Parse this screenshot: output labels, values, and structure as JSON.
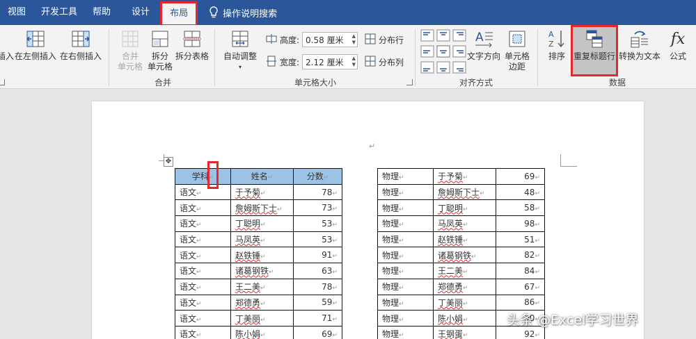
{
  "menubar": {
    "items": [
      "视图",
      "开发工具",
      "帮助",
      "设计",
      "布局"
    ],
    "search": "操作说明搜索"
  },
  "ribbon": {
    "rows_cols": {
      "insert_partial": "插入",
      "insert_left": "在左侧插入",
      "insert_right": "在右侧插入"
    },
    "merge": {
      "merge_cells_1": "合并",
      "merge_cells_2": "单元格",
      "split_cells_1": "拆分",
      "split_cells_2": "单元格",
      "split_table": "拆分表格",
      "label": "合并"
    },
    "cell_size": {
      "autofit": "自动调整",
      "height_label": "高度:",
      "height_value": "0.58 厘米",
      "width_label": "宽度:",
      "width_value": "2.12 厘米",
      "distribute_rows": "分布行",
      "distribute_cols": "分布列",
      "label": "单元格大小"
    },
    "alignment": {
      "text_direction": "文字方向",
      "cell_margins_1": "单元格",
      "cell_margins_2": "边距",
      "label": "对齐方式"
    },
    "data": {
      "sort": "排序",
      "repeat_header": "重复标题行",
      "convert_text": "转换为文本",
      "formula": "公式",
      "label": "数据"
    }
  },
  "table_left": {
    "headers": [
      "学科",
      "姓名",
      "分数"
    ],
    "rows": [
      [
        "语文",
        "于予菊",
        "78"
      ],
      [
        "语文",
        "詹姆斯下士",
        "73"
      ],
      [
        "语文",
        "丁聪明",
        "53"
      ],
      [
        "语文",
        "马凤英",
        "53"
      ],
      [
        "语文",
        "赵铁锤",
        "91"
      ],
      [
        "语文",
        "诸葛钢铁",
        "63"
      ],
      [
        "语文",
        "王二美",
        "78"
      ],
      [
        "语文",
        "郑德勇",
        "59"
      ],
      [
        "语文",
        "丁美丽",
        "71"
      ],
      [
        "语文",
        "陈小娟",
        "69"
      ]
    ]
  },
  "table_right": {
    "rows": [
      [
        "物理",
        "于予菊",
        "69"
      ],
      [
        "物理",
        "詹姆斯下士",
        "48"
      ],
      [
        "物理",
        "丁聪明",
        "58"
      ],
      [
        "物理",
        "马凤英",
        "98"
      ],
      [
        "物理",
        "赵铁锤",
        "51"
      ],
      [
        "物理",
        "诸葛钢铁",
        "82"
      ],
      [
        "物理",
        "王二美",
        "84"
      ],
      [
        "物理",
        "郑德勇",
        "67"
      ],
      [
        "物理",
        "丁美丽",
        "86"
      ],
      [
        "物理",
        "陈小娟",
        "90"
      ],
      [
        "物理",
        "王钢蛋",
        "92"
      ]
    ]
  },
  "watermark": "头条 @Excel学习世界",
  "colors": {
    "title_bar": "#2b579a",
    "ribbon_bg": "#f3f3f3",
    "header_fill": "#9cc3e5",
    "highlight": "#e8262c"
  }
}
